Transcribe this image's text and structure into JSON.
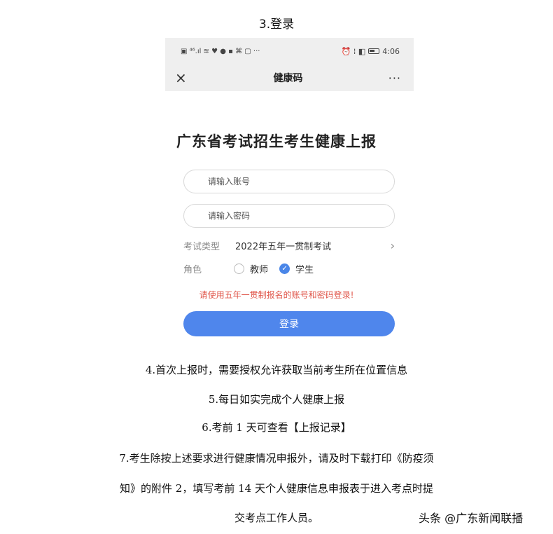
{
  "step3_title": "3.登录",
  "status_bar": {
    "left_icons": "▣ ⁴⁶.ıl ≋ ♥ ● ▪ ⌘ ▢ ···",
    "right_icons": "⏰ ⁞ ◧",
    "time": "4:06"
  },
  "app_header": {
    "close_icon": "×",
    "title": "健康码",
    "more_icon": "···"
  },
  "form": {
    "title": "广东省考试招生考生健康上报",
    "account_placeholder": "请输入账号",
    "password_placeholder": "请输入密码",
    "exam_type_label": "考试类型",
    "exam_type_value": "2022年五年一贯制考试",
    "role_label": "角色",
    "role_options": [
      "教师",
      "学生"
    ],
    "role_selected": "学生",
    "notice": "请使用五年一贯制报名的账号和密码登录!",
    "login_label": "登录",
    "accent_color": "#4f86ec",
    "notice_color": "#e0574b"
  },
  "steps": {
    "s4": "4.首次上报时，需要授权允许获取当前考生所在位置信息",
    "s5": "5.每日如实完成个人健康上报",
    "s6": "6.考前 1 天可查看【上报记录】",
    "s7_line1": "7.考生除按上述要求进行健康情况申报外，请及时下载打印《防疫须",
    "s7_line2": "知》的附件 2，填写考前 14 天个人健康信息申报表于进入考点时提",
    "s7_line3": "交考点工作人员。"
  },
  "watermark": "头条 @广东新闻联播"
}
